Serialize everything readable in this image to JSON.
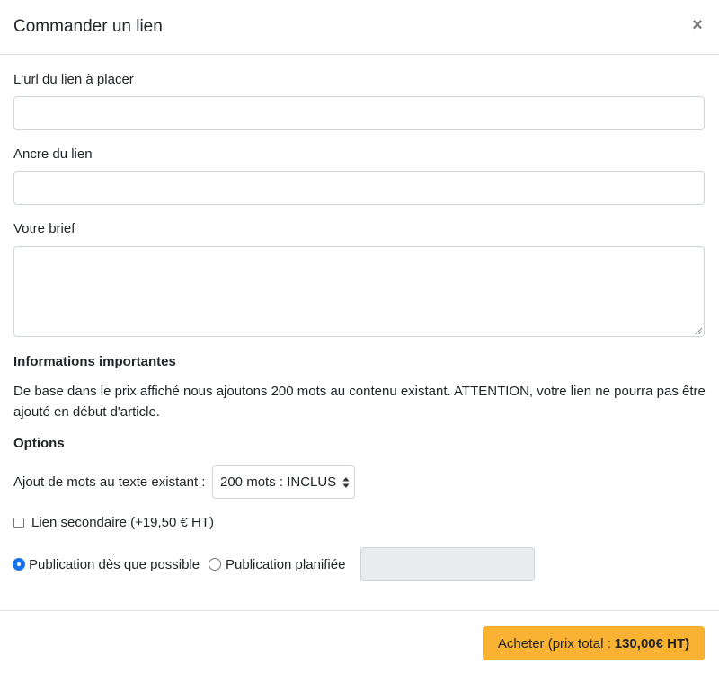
{
  "modal": {
    "title": "Commander un lien",
    "close_symbol": "×"
  },
  "form": {
    "url_label": "L'url du lien à placer",
    "url_value": "",
    "anchor_label": "Ancre du lien",
    "anchor_value": "",
    "brief_label": "Votre brief",
    "brief_value": ""
  },
  "info": {
    "heading": "Informations importantes",
    "text": "De base dans le prix affiché nous ajoutons 200 mots au contenu existant. ATTENTION, votre lien ne pourra pas être ajouté en début d'article."
  },
  "options": {
    "heading": "Options",
    "words_label": "Ajout de mots au texte existant :",
    "words_selected": "200 mots : INCLUS",
    "secondary_link_label": "Lien secondaire (+19,50 € HT)",
    "secondary_link_checked": false,
    "publish_asap_label": "Publication dès que possible",
    "publish_asap_checked": true,
    "publish_scheduled_label": "Publication planifiée",
    "publish_scheduled_checked": false,
    "schedule_date_value": ""
  },
  "footer": {
    "buy_label": "Acheter (prix total :",
    "buy_price": "130,00€ HT)"
  },
  "colors": {
    "accent": "#f9b232",
    "radio_checked": "#1a73e8",
    "disabled_field": "#e9ecef"
  },
  "icons": {
    "close": "close-icon",
    "select_arrows": "select-arrows-icon",
    "resize": "resize-grip-icon"
  }
}
